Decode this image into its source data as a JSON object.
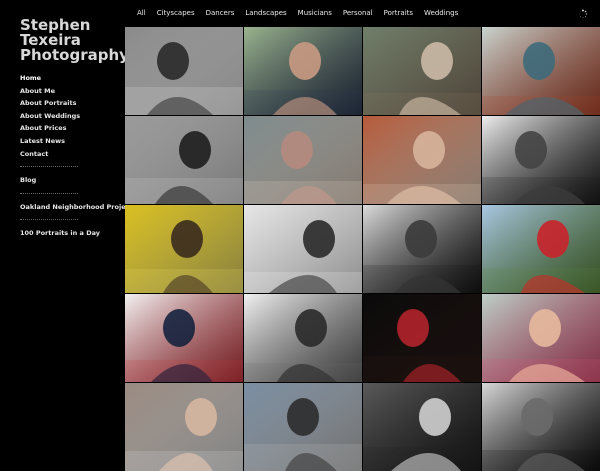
{
  "site": {
    "title": "Stephen Texeira Photography"
  },
  "sidebar": {
    "items": [
      {
        "label": "Home"
      },
      {
        "label": "About Me"
      },
      {
        "label": "About Portraits"
      },
      {
        "label": "About Weddings"
      },
      {
        "label": "About Prices"
      },
      {
        "label": "Latest News"
      },
      {
        "label": "Contact"
      },
      {
        "label": "Blog"
      },
      {
        "label": "Oakland Neighborhood Project"
      },
      {
        "label": "100 Portraits in a Day"
      }
    ]
  },
  "topnav": {
    "items": [
      {
        "label": "All"
      },
      {
        "label": "Cityscapes"
      },
      {
        "label": "Dancers"
      },
      {
        "label": "Landscapes"
      },
      {
        "label": "Musicians"
      },
      {
        "label": "Personal"
      },
      {
        "label": "Portraits"
      },
      {
        "label": "Weddings"
      }
    ],
    "loader_icon": "spinner-icon"
  },
  "gallery": {
    "tiles": [
      {
        "name": "photo-wedding-hands",
        "bg": "#8a8a8a",
        "fg": "#2a2a2a",
        "accent": "#f0f0f0",
        "style": "bw"
      },
      {
        "name": "photo-couple-kiss",
        "bg": "#9bb48e",
        "fg": "#c99a82",
        "accent": "#2f3b55",
        "style": "color"
      },
      {
        "name": "photo-woman-dog",
        "bg": "#6f7f6a",
        "fg": "#cbb9a6",
        "accent": "#8a7a66",
        "style": "color"
      },
      {
        "name": "photo-woman-lake",
        "bg": "#c9d4cf",
        "fg": "#3e6a7a",
        "accent": "#b2482f",
        "style": "color"
      },
      {
        "name": "photo-woman-building",
        "bg": "#9a9a9a",
        "fg": "#1e1e1e",
        "accent": "#d6d6d6",
        "style": "bw"
      },
      {
        "name": "photo-woman-river",
        "bg": "#7d8b8e",
        "fg": "#b58a7e",
        "accent": "#e7d7c8",
        "style": "color"
      },
      {
        "name": "photo-woman-scarf",
        "bg": "#b65a3a",
        "fg": "#d7b49c",
        "accent": "#f0d6c2",
        "style": "color"
      },
      {
        "name": "photo-woman-curls",
        "bg": "#eeeeee",
        "fg": "#444444",
        "accent": "#1b1b1b",
        "style": "bw"
      },
      {
        "name": "photo-woman-umbrella",
        "bg": "#d9c020",
        "fg": "#3a2a1e",
        "accent": "#f2e36a",
        "style": "color"
      },
      {
        "name": "photo-woman-earring",
        "bg": "#e6e6e6",
        "fg": "#2a2a2a",
        "accent": "#ffffff",
        "style": "bw"
      },
      {
        "name": "photo-woman-lips",
        "bg": "#dcdcdc",
        "fg": "#3b3b3b",
        "accent": "#151515",
        "style": "bw"
      },
      {
        "name": "photo-dancer-red",
        "bg": "#a9c7e3",
        "fg": "#c9232b",
        "accent": "#5c8a3e",
        "style": "color"
      },
      {
        "name": "photo-woman-feathers",
        "bg": "#f2f2f2",
        "fg": "#16223e",
        "accent": "#c9363e",
        "style": "color"
      },
      {
        "name": "photo-woman-shout",
        "bg": "#f0f0f0",
        "fg": "#2a2a2a",
        "accent": "#6b6b6b",
        "style": "bw"
      },
      {
        "name": "photo-dancer-dark",
        "bg": "#0a0a0a",
        "fg": "#b3232b",
        "accent": "#2a1a18",
        "style": "color"
      },
      {
        "name": "photo-woman-fitness",
        "bg": "#bcd0c8",
        "fg": "#e7b99c",
        "accent": "#e0557a",
        "style": "color"
      },
      {
        "name": "photo-woman-bottom-1",
        "bg": "#9a8a80",
        "fg": "#d6b7a1",
        "accent": "#e7e7e7",
        "style": "color"
      },
      {
        "name": "photo-man-bottom-2",
        "bg": "#7a8ea3",
        "fg": "#2c2c2c",
        "accent": "#c9c9c9",
        "style": "color"
      },
      {
        "name": "photo-bw-bottom-3",
        "bg": "#5a5a5a",
        "fg": "#cfcfcf",
        "accent": "#1f1f1f",
        "style": "bw"
      },
      {
        "name": "photo-portrait-bottom-4",
        "bg": "#d8d8d8",
        "fg": "#6a6a6a",
        "accent": "#111111",
        "style": "bw"
      }
    ]
  }
}
